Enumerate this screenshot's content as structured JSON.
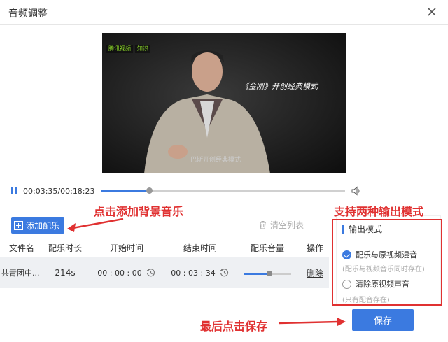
{
  "window": {
    "title": "音频调整"
  },
  "video": {
    "badge_left": "腾讯视频",
    "badge_right": "知识",
    "overlay_text": "《金刚》开创经典模式",
    "subtitle": "巴斯开创经典模式"
  },
  "player": {
    "time": "00:03:35/00:18:23",
    "progress_fraction": 0.195
  },
  "toolbar": {
    "add_label": "添加配乐",
    "clear_label": "清空列表"
  },
  "table": {
    "headers": [
      "文件名",
      "配乐时长",
      "开始时间",
      "结束时间",
      "配乐音量",
      "操作"
    ],
    "rows": [
      {
        "filename": "共青团中...",
        "duration": "214s",
        "start": "00 : 00 : 00",
        "end": "00 : 03 : 34",
        "volume_fraction": 0.55,
        "action": "删除"
      }
    ]
  },
  "output_mode": {
    "title": "输出模式",
    "option1": "配乐与原视频混音",
    "hint1": "(配乐与视频音乐同时存在)",
    "option2": "清除原视频声音",
    "hint2": "(只有配音存在)",
    "selected": 1
  },
  "save_label": "保存",
  "annotations": {
    "add": "点击添加背景音乐",
    "mode": "支持两种输出模式",
    "save": "最后点击保存"
  },
  "colors": {
    "accent": "#3b7ae0",
    "annotation": "#e03131"
  }
}
